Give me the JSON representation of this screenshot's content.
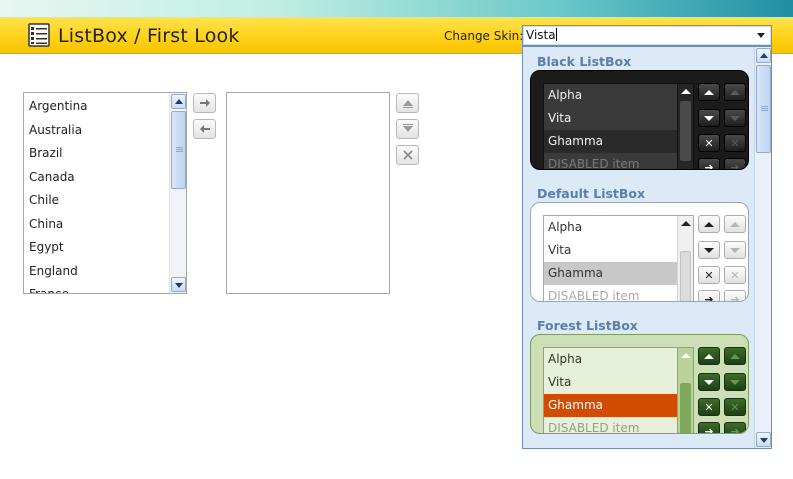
{
  "header": {
    "title": "ListBox / First Look",
    "skin_label": "Change Skin:",
    "skin_value": "Vista"
  },
  "source_list": {
    "items": [
      "Argentina",
      "Australia",
      "Brazil",
      "Canada",
      "Chile",
      "China",
      "Egypt",
      "England",
      "France"
    ]
  },
  "transfer_buttons": {
    "move_right_icon": "arrow-right-icon",
    "move_left_icon": "arrow-left-icon"
  },
  "order_buttons": {
    "move_up_icon": "move-up-icon",
    "move_down_icon": "move-down-icon",
    "delete_icon": "close-icon"
  },
  "skins": [
    {
      "key": "black",
      "title": "Black ListBox",
      "items": [
        "Alpha",
        "Vita",
        "Ghamma",
        "DISABLED item"
      ],
      "selected": 2,
      "disabled": 3
    },
    {
      "key": "default",
      "title": "Default ListBox",
      "items": [
        "Alpha",
        "Vita",
        "Ghamma",
        "DISABLED item"
      ],
      "selected": 2,
      "disabled": 3
    },
    {
      "key": "forest",
      "title": "Forest ListBox",
      "items": [
        "Alpha",
        "Vita",
        "Ghamma",
        "DISABLED item"
      ],
      "selected": 2,
      "disabled": 3
    }
  ],
  "colors": {
    "header_yellow": "#ffd21a",
    "forest_selection": "#d14b00",
    "skin_title_blue": "#5a7fa9"
  }
}
